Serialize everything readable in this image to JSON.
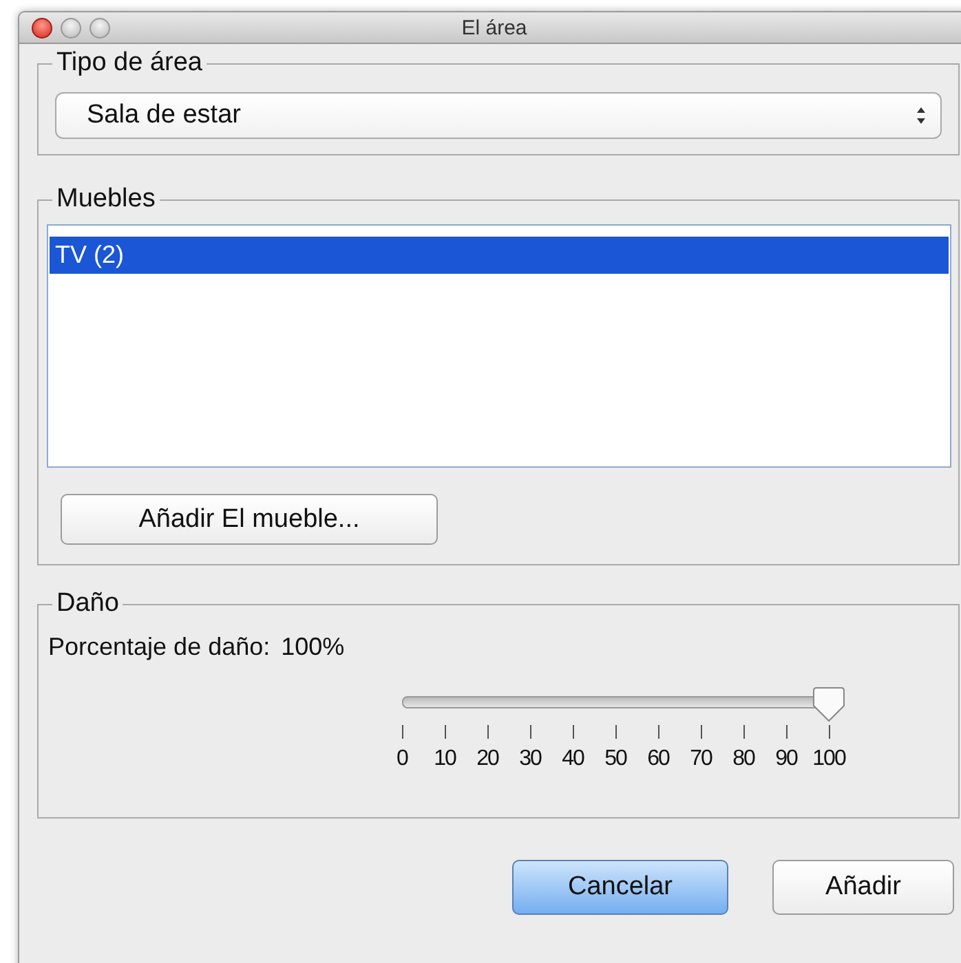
{
  "window": {
    "title": "El área"
  },
  "area_type": {
    "legend": "Tipo de área",
    "value": "Sala de estar"
  },
  "furniture": {
    "legend": "Muebles",
    "items": [
      {
        "label": "TV (2)",
        "selected": true
      }
    ],
    "add_button": "Añadir El mueble..."
  },
  "damage": {
    "legend": "Daño",
    "label": "Porcentaje de daño:",
    "reading": "100%",
    "slider": {
      "level": 1,
      "tick_labels": [
        "0",
        "10",
        "20",
        "30",
        "40",
        "50",
        "60",
        "70",
        "80",
        "90",
        "100"
      ]
    }
  },
  "buttons": [
    {
      "label": "Cancelar",
      "kind": "default"
    },
    {
      "label": "Añadir",
      "kind": "normal"
    }
  ]
}
